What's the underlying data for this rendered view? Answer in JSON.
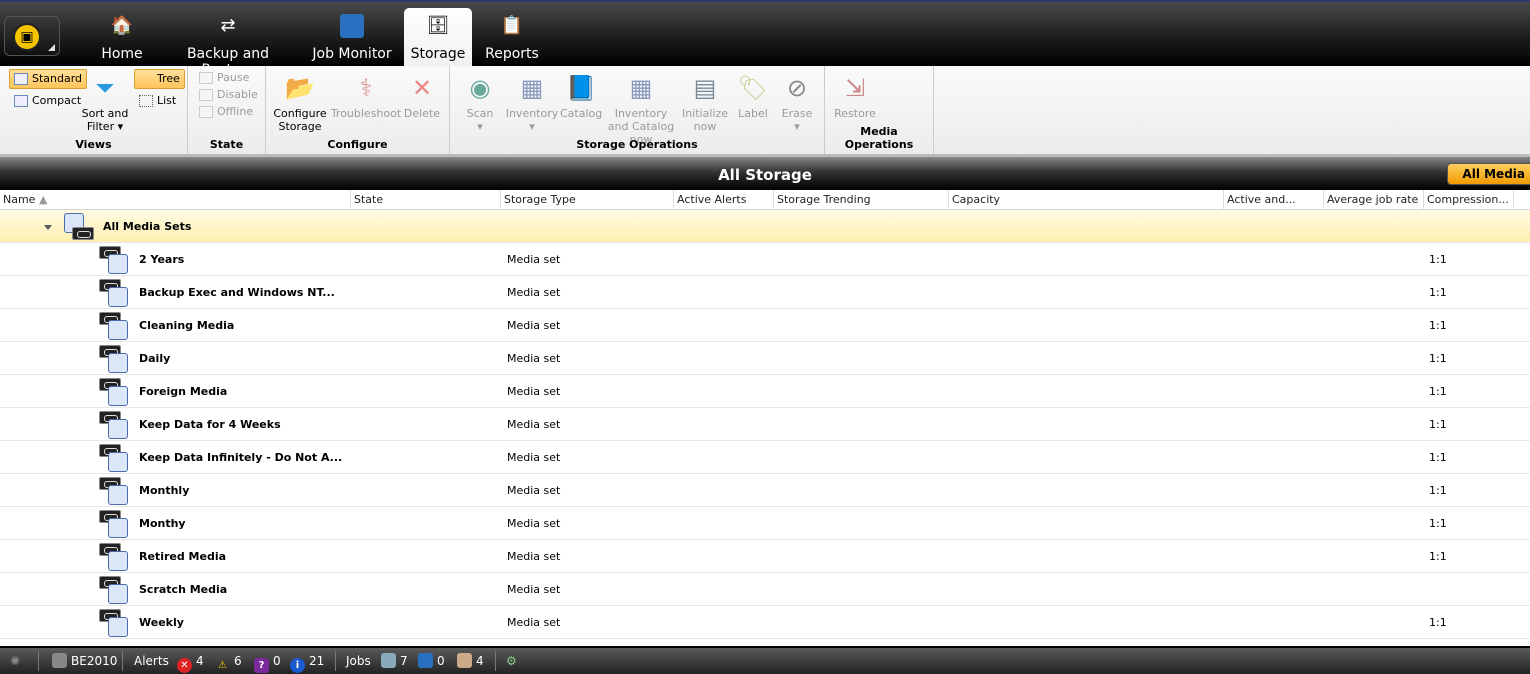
{
  "nav": {
    "tabs": [
      {
        "label": "Home",
        "icon": "home-icon"
      },
      {
        "label": "Backup and Restore",
        "icon": "backup-restore-icon"
      },
      {
        "label": "Job Monitor",
        "icon": "job-monitor-icon"
      },
      {
        "label": "Storage",
        "icon": "storage-icon",
        "active": true
      },
      {
        "label": "Reports",
        "icon": "reports-icon"
      }
    ]
  },
  "ribbon": {
    "views": {
      "label": "Views",
      "standard": "Standard",
      "compact": "Compact",
      "sort_filter": "Sort and Filter",
      "tree": "Tree",
      "list": "List"
    },
    "state": {
      "label": "State",
      "pause": "Pause",
      "disable": "Disable",
      "offline": "Offline"
    },
    "configure": {
      "label": "Configure",
      "configure_storage": "Configure Storage",
      "troubleshoot": "Troubleshoot",
      "delete": "Delete"
    },
    "storage_ops": {
      "label": "Storage Operations",
      "scan": "Scan",
      "inventory": "Inventory",
      "catalog": "Catalog",
      "inventory_catalog": "Inventory and Catalog now",
      "initialize": "Initialize now",
      "label_btn": "Label",
      "erase": "Erase"
    },
    "media_ops": {
      "label": "Media Operations",
      "restore": "Restore"
    }
  },
  "title": "All Storage",
  "title_button": "All Media",
  "columns": [
    "Name",
    "State",
    "Storage Type",
    "Active Alerts",
    "Storage Trending",
    "Capacity",
    "Active and...",
    "Average job rate",
    "Compression..."
  ],
  "group": {
    "name": "All Media Sets"
  },
  "rows": [
    {
      "name": "2 Years",
      "type": "Media set",
      "compression": "1:1"
    },
    {
      "name": "Backup Exec and Windows NT...",
      "type": "Media set",
      "compression": "1:1"
    },
    {
      "name": "Cleaning Media",
      "type": "Media set",
      "compression": "1:1"
    },
    {
      "name": "Daily",
      "type": "Media set",
      "compression": "1:1"
    },
    {
      "name": "Foreign Media",
      "type": "Media set",
      "compression": "1:1"
    },
    {
      "name": "Keep Data for 4 Weeks",
      "type": "Media set",
      "compression": "1:1"
    },
    {
      "name": "Keep Data Infinitely - Do Not A...",
      "type": "Media set",
      "compression": "1:1"
    },
    {
      "name": "Monthly",
      "type": "Media set",
      "compression": "1:1"
    },
    {
      "name": "Monthy",
      "type": "Media set",
      "compression": "1:1"
    },
    {
      "name": "Retired Media",
      "type": "Media set",
      "compression": "1:1"
    },
    {
      "name": "Scratch Media",
      "type": "Media set",
      "compression": ""
    },
    {
      "name": "Weekly",
      "type": "Media set",
      "compression": "1:1"
    }
  ],
  "status": {
    "server": "BE2010",
    "alerts_label": "Alerts",
    "errors": "4",
    "warnings": "6",
    "questions": "0",
    "info": "21",
    "jobs_label": "Jobs",
    "scheduled": "7",
    "active": "0",
    "queued": "4"
  },
  "colors": {
    "accent": "#ffc55a",
    "group_row": "#fff3c0",
    "status_bg": "#333333"
  }
}
